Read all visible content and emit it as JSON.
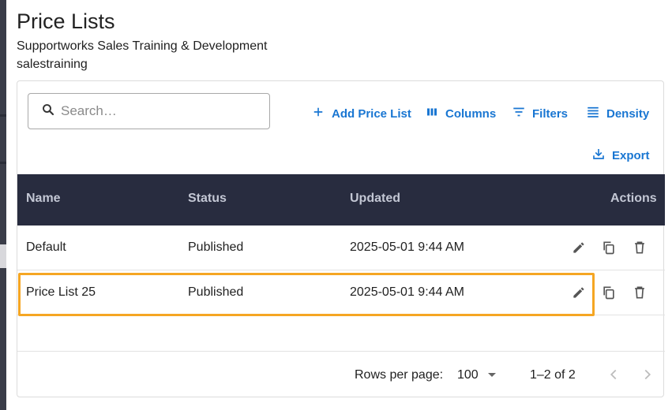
{
  "page": {
    "title": "Price Lists",
    "org_name": "Supportworks Sales Training & Development",
    "org_sub": "salestraining"
  },
  "toolbar": {
    "search_placeholder": "Search…",
    "add_label": "Add Price List",
    "columns_label": "Columns",
    "filters_label": "Filters",
    "density_label": "Density",
    "export_label": "Export"
  },
  "table": {
    "columns": [
      "Name",
      "Status",
      "Updated",
      "Actions"
    ],
    "rows": [
      {
        "name": "Default",
        "status": "Published",
        "updated": "2025-05-01 9:44 AM"
      },
      {
        "name": "Price List 25",
        "status": "Published",
        "updated": "2025-05-01 9:44 AM"
      }
    ],
    "highlighted_row": 1
  },
  "pagination": {
    "rows_per_page_label": "Rows per page:",
    "rows_per_page_value": "100",
    "range": "1–2 of 2"
  },
  "icons": {
    "search": "search-icon",
    "add": "plus-icon",
    "columns": "columns-icon",
    "filters": "filter-icon",
    "density": "density-icon",
    "export": "download-icon",
    "edit": "pencil-icon",
    "copy": "copy-icon",
    "delete": "trash-icon",
    "prev": "chevron-left-icon",
    "next": "chevron-right-icon"
  },
  "colors": {
    "accent": "#1976d2",
    "header_bg": "#282c3f",
    "highlight": "#f5a623"
  }
}
